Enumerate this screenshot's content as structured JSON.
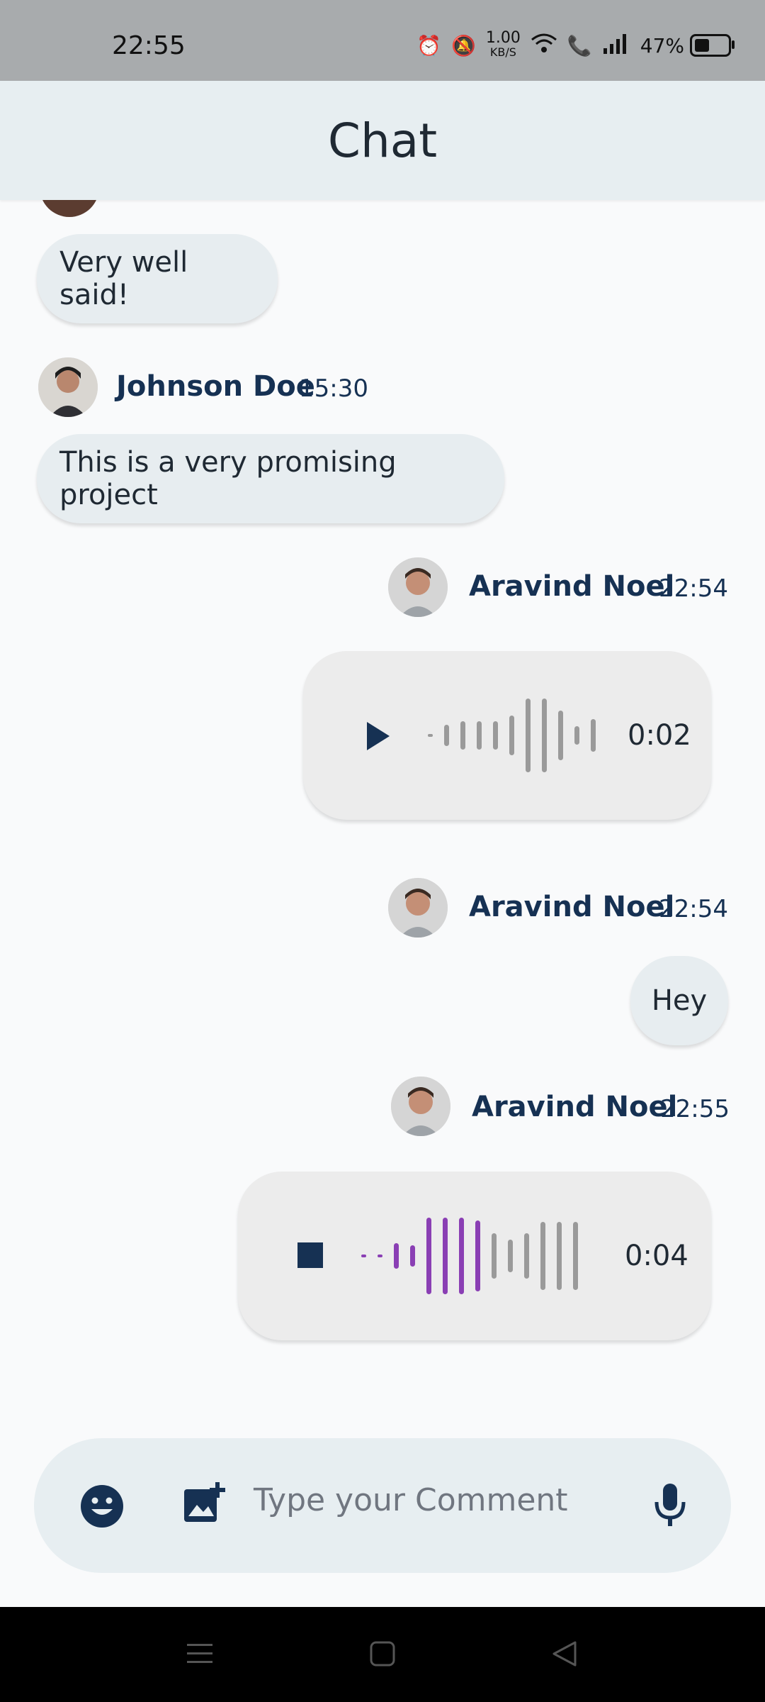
{
  "status": {
    "time": "22:55",
    "speed": "1.00",
    "speed_unit": "KB/S",
    "battery": "47%"
  },
  "header": {
    "title": "Chat"
  },
  "messages": [
    {
      "text": "Very well said!"
    },
    {
      "name": "Johnson Doe",
      "time": "15:30",
      "text": "This is a very promising project"
    },
    {
      "name": "Aravind Noel",
      "time": "22:54",
      "duration": "0:02",
      "progress": 0
    },
    {
      "name": "Aravind Noel",
      "time": "22:54",
      "text": "Hey"
    },
    {
      "name": "Aravind Noel",
      "time": "22:55",
      "duration": "0:04",
      "progress": 0.5
    }
  ],
  "composer": {
    "placeholder": "Type your Comment"
  },
  "colors": {
    "accent": "#163153",
    "wave_active": "#8a3fb4",
    "wave_idle": "#9a9a9a"
  }
}
